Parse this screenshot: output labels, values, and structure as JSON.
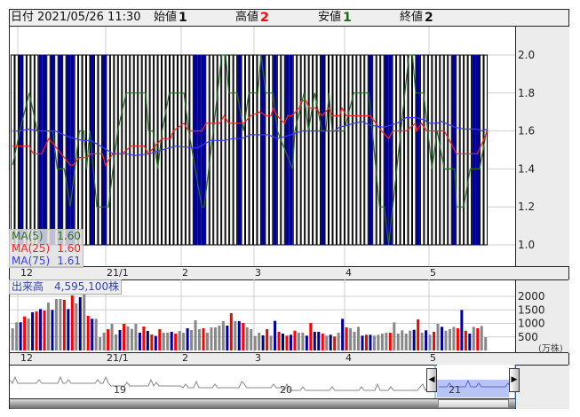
{
  "header": {
    "date_label": "日付",
    "date_value": "2021/05/26 11:30",
    "open_label": "始値",
    "open_value": "1",
    "high_label": "高値",
    "high_value": "2",
    "low_label": "安値",
    "low_value": "1",
    "close_label": "終値",
    "close_value": "2"
  },
  "legend": [
    {
      "name": "MA(5)",
      "value": "1.60",
      "color": "#2a6e2a"
    },
    {
      "name": "MA(25)",
      "value": "1.60",
      "color": "#ff2020"
    },
    {
      "name": "MA(75)",
      "value": "1.61",
      "color": "#3a3aff"
    }
  ],
  "volume_title": "出来高　4,595,100株",
  "volume_unit": "(万株)",
  "date_labels": [
    "12",
    "21/1",
    "2",
    "3",
    "4",
    "5"
  ],
  "navigator_labels": [
    "19",
    "20",
    "21"
  ],
  "colors": {
    "up": "#ff0000",
    "down": "#000099",
    "flat": "#888888",
    "candle_fill": "#000099"
  },
  "chart_data": [
    {
      "type": "candlestick",
      "title": "",
      "ylim": [
        1.0,
        2.0
      ],
      "yticks": [
        "2.0",
        "1.8",
        "1.6",
        "1.4",
        "1.2",
        "1.0"
      ],
      "bar_count": 120,
      "candle_high": 2.0,
      "candle_low": 1.0,
      "filled_candle_indices": [
        2,
        7,
        8,
        10,
        12,
        14,
        15,
        20,
        23,
        46,
        47,
        48,
        57,
        63,
        66,
        69,
        70,
        78,
        90,
        94,
        95,
        102,
        111,
        116,
        117
      ],
      "series": [
        {
          "name": "MA(5)",
          "points": [
            [
              0,
              1.42
            ],
            [
              1.8,
              1.6
            ],
            [
              4.2,
              1.8
            ],
            [
              6.2,
              1.6
            ],
            [
              10.1,
              1.6
            ],
            [
              11.2,
              1.4
            ],
            [
              13,
              1.4
            ],
            [
              14.5,
              1.2
            ],
            [
              16.8,
              1.6
            ],
            [
              17.9,
              1.6
            ],
            [
              18.6,
              1.4
            ],
            [
              19.4,
              1.6
            ],
            [
              21.2,
              1.2
            ],
            [
              24.1,
              1.2
            ],
            [
              26.4,
              1.6
            ],
            [
              28.6,
              1.8
            ],
            [
              33.5,
              1.8
            ],
            [
              34.2,
              1.6
            ],
            [
              35.3,
              1.6
            ],
            [
              36.5,
              1.4
            ],
            [
              37.6,
              1.6
            ],
            [
              39.4,
              1.8
            ],
            [
              43.1,
              1.8
            ],
            [
              44.3,
              1.6
            ],
            [
              47.6,
              1.2
            ],
            [
              48.2,
              1.2
            ],
            [
              50.5,
              1.6
            ],
            [
              52.6,
              2.0
            ],
            [
              53.6,
              2.0
            ],
            [
              54.4,
              1.8
            ],
            [
              56.5,
              1.8
            ],
            [
              58.1,
              1.6
            ],
            [
              59.4,
              1.8
            ],
            [
              61.7,
              1.8
            ],
            [
              62.5,
              2.0
            ],
            [
              63.7,
              1.8
            ],
            [
              65.5,
              1.8
            ],
            [
              66.6,
              1.6
            ],
            [
              70.4,
              1.4
            ],
            [
              71,
              1.6
            ],
            [
              73.3,
              1.8
            ],
            [
              74.4,
              1.6
            ],
            [
              76,
              1.8
            ],
            [
              77.8,
              1.6
            ],
            [
              78.8,
              1.6
            ],
            [
              79.6,
              1.8
            ],
            [
              80.4,
              1.6
            ],
            [
              83.4,
              1.6
            ],
            [
              85.8,
              1.8
            ],
            [
              89.6,
              1.8
            ],
            [
              92.3,
              1.2
            ],
            [
              93.5,
              1.2
            ],
            [
              94.6,
              1.0
            ],
            [
              99.7,
              2.0
            ],
            [
              100.6,
              2.0
            ],
            [
              101.4,
              1.8
            ],
            [
              103.4,
              1.8
            ],
            [
              105.5,
              1.4
            ],
            [
              106.8,
              1.6
            ],
            [
              108.6,
              1.4
            ],
            [
              111.2,
              1.4
            ],
            [
              111.7,
              1.2
            ],
            [
              113.5,
              1.2
            ],
            [
              115.1,
              1.4
            ],
            [
              117.5,
              1.4
            ],
            [
              119.2,
              1.6
            ]
          ]
        },
        {
          "name": "MA(25)",
          "points": [
            [
              0,
              1.52
            ],
            [
              4.2,
              1.52
            ],
            [
              5.2,
              1.48
            ],
            [
              7.3,
              1.48
            ],
            [
              9.1,
              1.56
            ],
            [
              13,
              1.46
            ],
            [
              14.5,
              1.42
            ],
            [
              15.2,
              1.42
            ],
            [
              16.8,
              1.46
            ],
            [
              18.6,
              1.46
            ],
            [
              19.7,
              1.48
            ],
            [
              22.6,
              1.48
            ],
            [
              23.3,
              1.42
            ],
            [
              25.2,
              1.48
            ],
            [
              27.5,
              1.48
            ],
            [
              29.8,
              1.52
            ],
            [
              33.1,
              1.52
            ],
            [
              34.2,
              1.48
            ],
            [
              35.8,
              1.52
            ],
            [
              37.6,
              1.56
            ],
            [
              39.7,
              1.56
            ],
            [
              40.4,
              1.6
            ],
            [
              43.1,
              1.64
            ],
            [
              44.3,
              1.6
            ],
            [
              47.6,
              1.6
            ],
            [
              48.7,
              1.64
            ],
            [
              52.1,
              1.64
            ],
            [
              53.2,
              1.68
            ],
            [
              54.4,
              1.64
            ],
            [
              58.1,
              1.64
            ],
            [
              59.9,
              1.68
            ],
            [
              62.2,
              1.7
            ],
            [
              63.7,
              1.68
            ],
            [
              65,
              1.68
            ],
            [
              65.5,
              1.72
            ],
            [
              66.6,
              1.68
            ],
            [
              68.4,
              1.64
            ],
            [
              69.2,
              1.68
            ],
            [
              70.2,
              1.68
            ],
            [
              72.1,
              1.72
            ],
            [
              72.6,
              1.76
            ],
            [
              73.8,
              1.76
            ],
            [
              74.6,
              1.72
            ],
            [
              76.2,
              1.72
            ],
            [
              77.8,
              1.68
            ],
            [
              79.6,
              1.72
            ],
            [
              80.4,
              1.68
            ],
            [
              82.2,
              1.68
            ],
            [
              82.9,
              1.72
            ],
            [
              84,
              1.68
            ],
            [
              90,
              1.68
            ],
            [
              92.8,
              1.6
            ],
            [
              94.6,
              1.56
            ],
            [
              95.6,
              1.6
            ],
            [
              99,
              1.6
            ],
            [
              101.3,
              1.64
            ],
            [
              101.6,
              1.6
            ],
            [
              102.8,
              1.64
            ],
            [
              104.2,
              1.6
            ],
            [
              108.6,
              1.6
            ],
            [
              111.7,
              1.48
            ],
            [
              116.9,
              1.48
            ],
            [
              119.5,
              1.6
            ]
          ]
        },
        {
          "name": "MA(75)",
          "points": [
            [
              0,
              1.6
            ],
            [
              1.8,
              1.6
            ],
            [
              4.1,
              1.61
            ],
            [
              6.2,
              1.6
            ],
            [
              10.7,
              1.6
            ],
            [
              14,
              1.57
            ],
            [
              17.4,
              1.55
            ],
            [
              19.7,
              1.55
            ],
            [
              23,
              1.51
            ],
            [
              25.2,
              1.48
            ],
            [
              28.6,
              1.48
            ],
            [
              30.8,
              1.47
            ],
            [
              34.2,
              1.48
            ],
            [
              37.6,
              1.5
            ],
            [
              40.9,
              1.52
            ],
            [
              46.4,
              1.51
            ],
            [
              49.8,
              1.55
            ],
            [
              53.2,
              1.55
            ],
            [
              55.4,
              1.56
            ],
            [
              57.6,
              1.56
            ],
            [
              59.9,
              1.58
            ],
            [
              64.3,
              1.58
            ],
            [
              66.6,
              1.56
            ],
            [
              70,
              1.58
            ],
            [
              72.8,
              1.6
            ],
            [
              81.1,
              1.6
            ],
            [
              82.2,
              1.62
            ],
            [
              87.8,
              1.65
            ],
            [
              90,
              1.63
            ],
            [
              93.4,
              1.62
            ],
            [
              96.7,
              1.64
            ],
            [
              99,
              1.67
            ],
            [
              101.3,
              1.67
            ],
            [
              103.4,
              1.66
            ],
            [
              105,
              1.64
            ],
            [
              106.8,
              1.64
            ],
            [
              107.9,
              1.65
            ],
            [
              111.2,
              1.62
            ],
            [
              113.5,
              1.61
            ],
            [
              116.9,
              1.61
            ],
            [
              118,
              1.6
            ],
            [
              119.5,
              1.61
            ]
          ]
        }
      ]
    },
    {
      "type": "bar",
      "title": "出来高",
      "ylabel": "(万株)",
      "ylim": [
        0,
        2000
      ],
      "yticks": [
        "2000",
        "1500",
        "1000",
        "500"
      ],
      "values": [
        820,
        1039,
        1039,
        1257,
        1180,
        1410,
        1443,
        1530,
        1475,
        1770,
        1497,
        1902,
        1902,
        1869,
        1530,
        2033,
        1738,
        1967,
        2098,
        1279,
        1170,
        1170,
        492,
        656,
        787,
        984,
        590,
        754,
        984,
        885,
        798,
        984,
        656,
        885,
        721,
        590,
        536,
        787,
        656,
        656,
        689,
        623,
        721,
        656,
        820,
        754,
        1115,
        787,
        820,
        656,
        852,
        852,
        918,
        1082,
        918,
        1377,
        1082,
        1082,
        1016,
        852,
        787,
        536,
        656,
        557,
        787,
        547,
        1093,
        689,
        623,
        547,
        579,
        732,
        656,
        656,
        547,
        1016,
        689,
        689,
        623,
        547,
        579,
        514,
        656,
        1169,
        852,
        820,
        689,
        874,
        547,
        579,
        579,
        547,
        579,
        623,
        656,
        656,
        1038,
        623,
        743,
        623,
        732,
        765,
        1148,
        656,
        743,
        579,
        689,
        984,
        874,
        732,
        787,
        874,
        820,
        1497,
        732,
        623,
        874,
        820,
        907,
        492
      ],
      "colors": "ggbrgbrbrgbggrbrgbgrbgggrggbrgggbrbrbrggbrggbgggrgggggbrgbrggggbrgbrbrbrggbrbbrgbrgbrgggbrbggggrgggggbrgbgrgbgggrbrbgrgg"
    }
  ]
}
